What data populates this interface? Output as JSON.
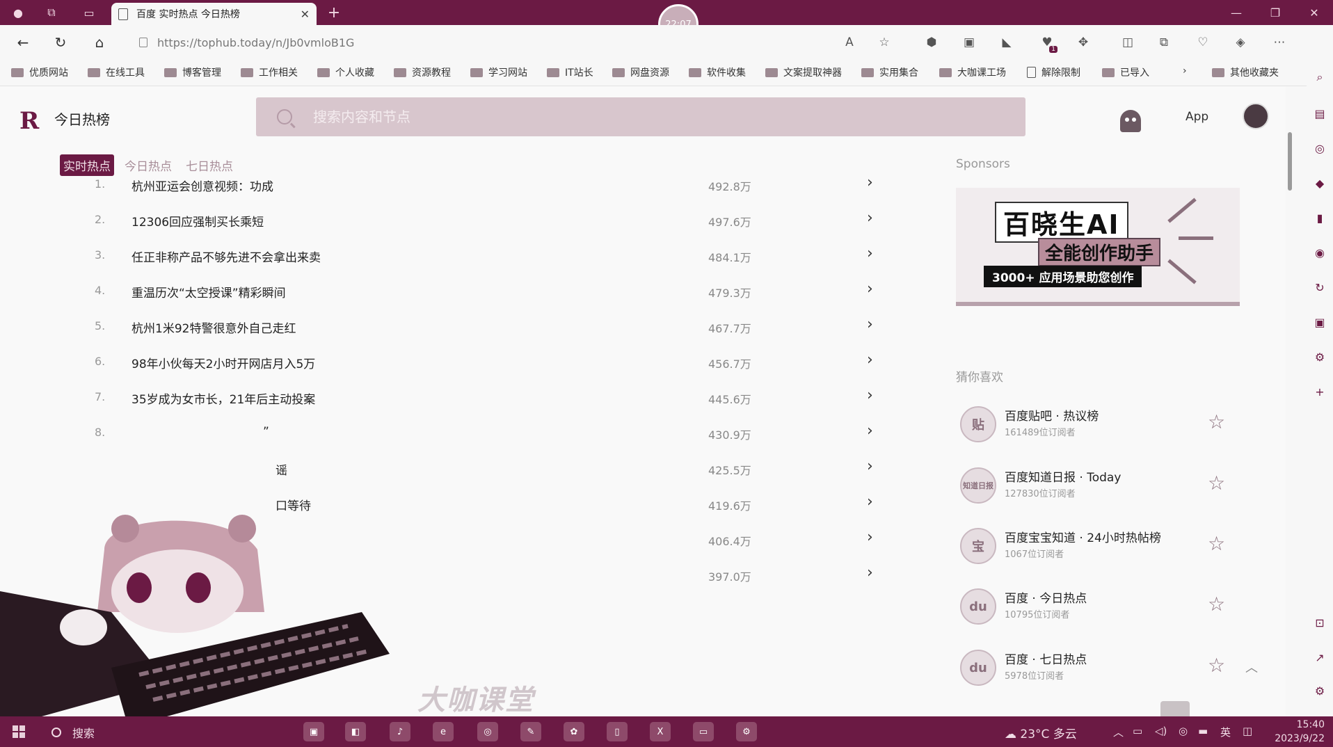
{
  "browser": {
    "tab_title": "百度 实时热点 今日热榜",
    "clock_badge": "22:07",
    "url": "https://tophub.today/n/Jb0vmloB1G",
    "extension_badge": "1"
  },
  "bookmarks": [
    "优质网站",
    "在线工具",
    "博客管理",
    "工作相关",
    "个人收藏",
    "资源教程",
    "学习网站",
    "IT站长",
    "网盘资源",
    "软件收集",
    "文案提取神器",
    "实用集合",
    "大咖课工场",
    "解除限制",
    "已导入"
  ],
  "bookmarks_more": "其他收藏夹",
  "header": {
    "logo": "R",
    "site_name": "今日热榜",
    "search_placeholder": "搜索内容和节点",
    "app_label": "App"
  },
  "tabs": [
    {
      "label": "实时热点",
      "active": true
    },
    {
      "label": "今日热点",
      "active": false
    },
    {
      "label": "七日热点",
      "active": false
    }
  ],
  "hot_list": [
    {
      "num": "1.",
      "title": "杭州亚运会创意视频：功成",
      "heat": "492.8万"
    },
    {
      "num": "2.",
      "title": "12306回应强制买长乘短",
      "heat": "497.6万"
    },
    {
      "num": "3.",
      "title": "任正非称产品不够先进不会拿出来卖",
      "heat": "484.1万"
    },
    {
      "num": "4.",
      "title": "重温历次“太空授课”精彩瞬间",
      "heat": "479.3万"
    },
    {
      "num": "5.",
      "title": "杭州1米92特警很意外自己走红",
      "heat": "467.7万"
    },
    {
      "num": "6.",
      "title": "98年小伙每天2小时开网店月入5万",
      "heat": "456.7万"
    },
    {
      "num": "7.",
      "title": "35岁成为女市长，21年后主动投案",
      "heat": "445.6万"
    },
    {
      "num": "8.",
      "title": "”",
      "heat": "430.9万"
    },
    {
      "num": "",
      "title": "谣",
      "heat": "425.5万"
    },
    {
      "num": "",
      "title": "口等待",
      "heat": "419.6万"
    },
    {
      "num": "",
      "title": "",
      "heat": "406.4万"
    },
    {
      "num": "",
      "title": "",
      "heat": "397.0万"
    }
  ],
  "sponsors": {
    "label": "Sponsors",
    "ad_title": "百晓生AI",
    "ad_subtitle": "全能创作助手",
    "ad_strip": "3000+ 应用场景助您创作"
  },
  "guess": {
    "label": "猜你喜欢",
    "items": [
      {
        "avatar": "贴",
        "name": "百度贴吧 · 热议榜",
        "meta": "161489位订阅者"
      },
      {
        "avatar": "知道日报",
        "name": "百度知道日报 · Today",
        "meta": "127830位订阅者"
      },
      {
        "avatar": "宝",
        "name": "百度宝宝知道 · 24小时热帖榜",
        "meta": "1067位订阅者"
      },
      {
        "avatar": "du",
        "name": "百度 · 今日热点",
        "meta": "10795位订阅者"
      },
      {
        "avatar": "du",
        "name": "百度 · 七日热点",
        "meta": "5978位订阅者"
      }
    ]
  },
  "watermark": "大咖课堂",
  "taskbar": {
    "search": "搜索",
    "weather": "23°C 多云",
    "ime": "英",
    "time": "15:40",
    "date": "2023/9/22"
  },
  "colors": {
    "accent": "#6b1a44",
    "muted": "#a88e99"
  }
}
